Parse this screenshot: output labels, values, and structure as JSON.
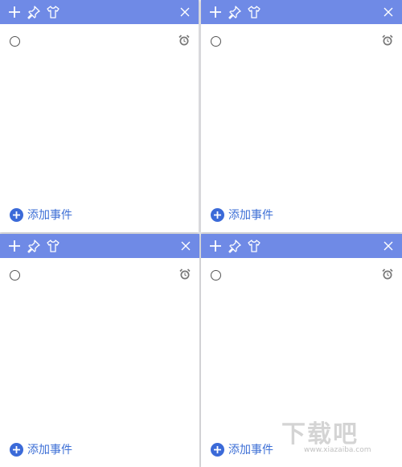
{
  "notes": [
    {
      "add_event_label": "添加事件"
    },
    {
      "add_event_label": "添加事件"
    },
    {
      "add_event_label": "添加事件"
    },
    {
      "add_event_label": "添加事件"
    }
  ],
  "titlebar_color": "#6f8ae6",
  "accent_color": "#3d6fd6",
  "icons": {
    "new_note": "plus-icon",
    "pin": "pin-icon",
    "theme": "shirt-icon",
    "close": "close-icon",
    "alarm": "alarm-clock-icon",
    "add": "add-circle-icon"
  },
  "watermark": {
    "text": "下载吧",
    "url": "www.xiazaiba.com"
  }
}
